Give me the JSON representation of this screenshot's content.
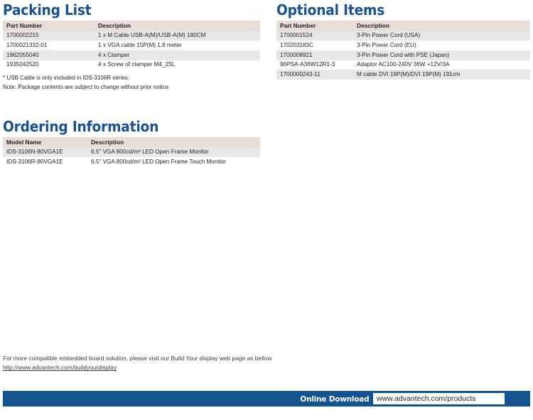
{
  "packing_list": {
    "title": "Packing List",
    "columns": [
      "Part Number",
      "Description"
    ],
    "rows": [
      [
        "1700002215",
        "1 x M Cable USB-A(M)/USB-A(M) 180CM"
      ],
      [
        "1700021332-01",
        "1 x VGA cable 15P(M) 1.8 meter"
      ],
      [
        "1962055040",
        "4 x Clamper"
      ],
      [
        "1935042520",
        "4 x Screw of clamper M4_25L"
      ]
    ],
    "notes": [
      "* USB Cable is only included in IDS-3106R series.",
      "Note: Package contents are subject to change without prior notice"
    ]
  },
  "optional_items": {
    "title": "Optional Items",
    "columns": [
      "Part Number",
      "Description"
    ],
    "rows": [
      [
        "1700001524",
        "3-Pin Power Cord (USA)"
      ],
      [
        "170203183C",
        "3-Pin Power Cord  (EU)"
      ],
      [
        "1700008921",
        "3-Pin Power Cord with PSE (Japan)"
      ],
      [
        "96PSA-A36W12R1-3",
        "Adaptor AC100-240V 36W +12V/3A"
      ],
      [
        "1700000243-11",
        " M cable DVI 19P(M)/DVI 19P(M) 191cm"
      ]
    ]
  },
  "ordering_information": {
    "title": "Ordering Information",
    "columns": [
      "Model Name",
      "Description"
    ],
    "rows": [
      [
        "IDS-3106N-80VGA1E",
        "6.5\" VGA 800cd/m² LED Open Frame Monitor"
      ],
      [
        "IDS-3106R-80VGA1E",
        "6.5\" VGA 800cd/m² LED Open Frame Touch Monitor"
      ]
    ]
  },
  "footer": {
    "note_line": "For more compatible embedded board solution,  please visit our Build Your display web page as bellow",
    "note_url": "http://www.advantech.com/buildyourdisplay",
    "download_label": "Online Download",
    "download_url": "www.advantech.com/products"
  },
  "colors": {
    "heading_blue": "#1b5091",
    "bar_blue": "#14538d",
    "table_header_bg": "#e9ded7",
    "row_alt_bg": "#e7e7e7"
  }
}
